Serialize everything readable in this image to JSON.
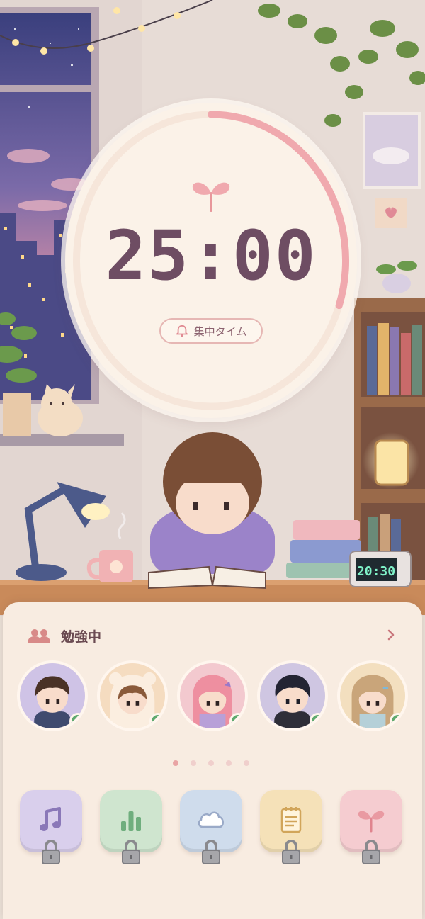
{
  "timer": {
    "time": "25:00",
    "mode_label": "集中タイム",
    "progress": 0.3,
    "icons": {
      "sprout": "sprout-icon",
      "bell": "bell-icon"
    }
  },
  "desk": {
    "clock_time": "20:30"
  },
  "study_panel": {
    "title": "勉強中",
    "icons": {
      "people": "people-icon",
      "chevron": "chevron-right-icon"
    },
    "avatars": [
      {
        "name": "avatar-boy-brown-hair",
        "bg": "#cfc3e6",
        "online": true
      },
      {
        "name": "avatar-girl-bear-hood",
        "bg": "#f5dcc0",
        "online": true
      },
      {
        "name": "avatar-girl-pink-hair",
        "bg": "#f3c9cf",
        "online": true
      },
      {
        "name": "avatar-boy-black-hair",
        "bg": "#cfc6e2",
        "online": true
      },
      {
        "name": "avatar-girl-blonde-hair",
        "bg": "#f3dfbf",
        "online": true
      }
    ],
    "page_indicator": {
      "count": 5,
      "active": 0
    }
  },
  "tools": [
    {
      "name": "music-tool",
      "icon": "music-note-icon",
      "bg": "#d9cfec",
      "locked": true
    },
    {
      "name": "stats-tool",
      "icon": "bar-chart-icon",
      "bg": "#cfe5cf",
      "locked": true
    },
    {
      "name": "weather-tool",
      "icon": "cloud-icon",
      "bg": "#cfdcec",
      "locked": true
    },
    {
      "name": "notes-tool",
      "icon": "notepad-icon",
      "bg": "#f5e1b8",
      "locked": true
    },
    {
      "name": "growth-tool",
      "icon": "sprout-icon",
      "bg": "#f5ccd0",
      "locked": true
    }
  ],
  "colors": {
    "accent_pink": "#f0a9ae",
    "timer_text": "#6e4d63",
    "online_green": "#5ea96e",
    "panel_bg": "#f8ece1"
  }
}
